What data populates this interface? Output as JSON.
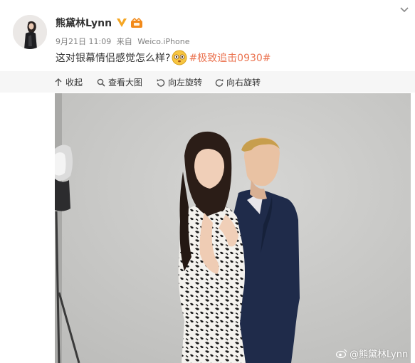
{
  "post": {
    "user_name": "熊黛林Lynn",
    "timestamp": "9月21日 11:09",
    "via_prefix": "来自",
    "source": "Weico.iPhone",
    "text": "这对银幕情侣感觉怎么样?",
    "hashtag": "#极致追击0930#"
  },
  "actions": {
    "collapse": "收起",
    "view_large": "查看大图",
    "rotate_left": "向左旋转",
    "rotate_right": "向右旋转"
  },
  "watermark": "@熊黛林Lynn",
  "icons": {
    "menu": "chevron-down-icon",
    "verified": "verified-v-icon",
    "member": "member-badge-icon",
    "emoji": "curious-face-emoji",
    "collapse": "arrow-up-icon",
    "view_large": "magnifier-icon",
    "rotate_left": "rotate-left-icon",
    "rotate_right": "rotate-right-icon",
    "watermark": "weibo-logo-icon"
  },
  "colors": {
    "hashtag": "#eb7350",
    "verified": "#f5a623",
    "meta_text": "#808080",
    "action_bar": "#f6f6f6"
  }
}
